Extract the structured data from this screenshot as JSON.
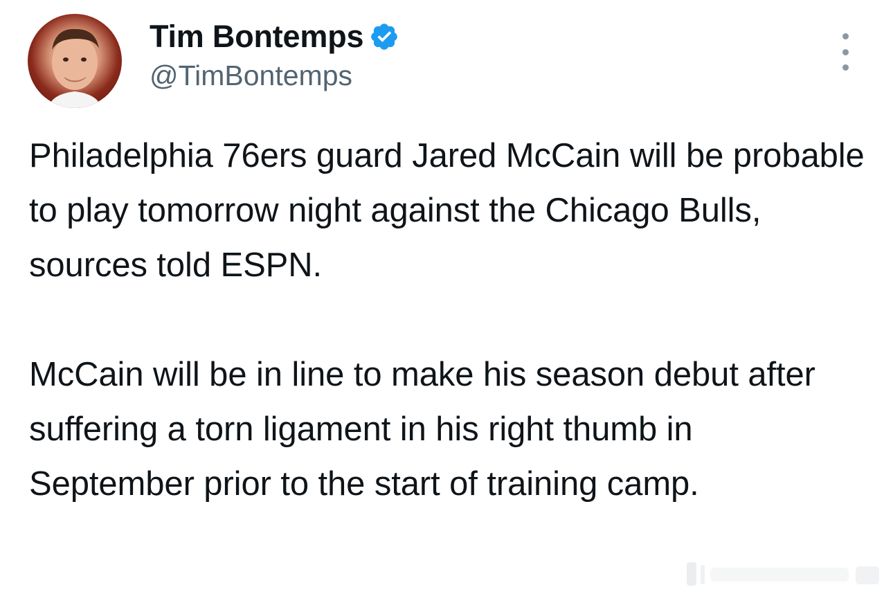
{
  "author": {
    "display_name": "Tim Bontemps",
    "handle": "@TimBontemps",
    "verified": true,
    "avatar_icon": "profile-photo"
  },
  "tweet": {
    "paragraphs": [
      "Philadelphia 76ers guard Jared McCain will be probable to play tomorrow night against the Chicago Bulls, sources told ESPN.",
      "McCain will be in line to make his season debut after suffering a torn ligament in his right thumb in September prior to the start of training camp."
    ]
  },
  "icons": {
    "verified": "verified-badge-icon",
    "more": "more-options-icon",
    "watermark": "watermark-logo"
  },
  "colors": {
    "text_primary": "#0f1419",
    "text_secondary": "#536471",
    "verified_blue": "#1d9bf0",
    "background": "#ffffff"
  }
}
